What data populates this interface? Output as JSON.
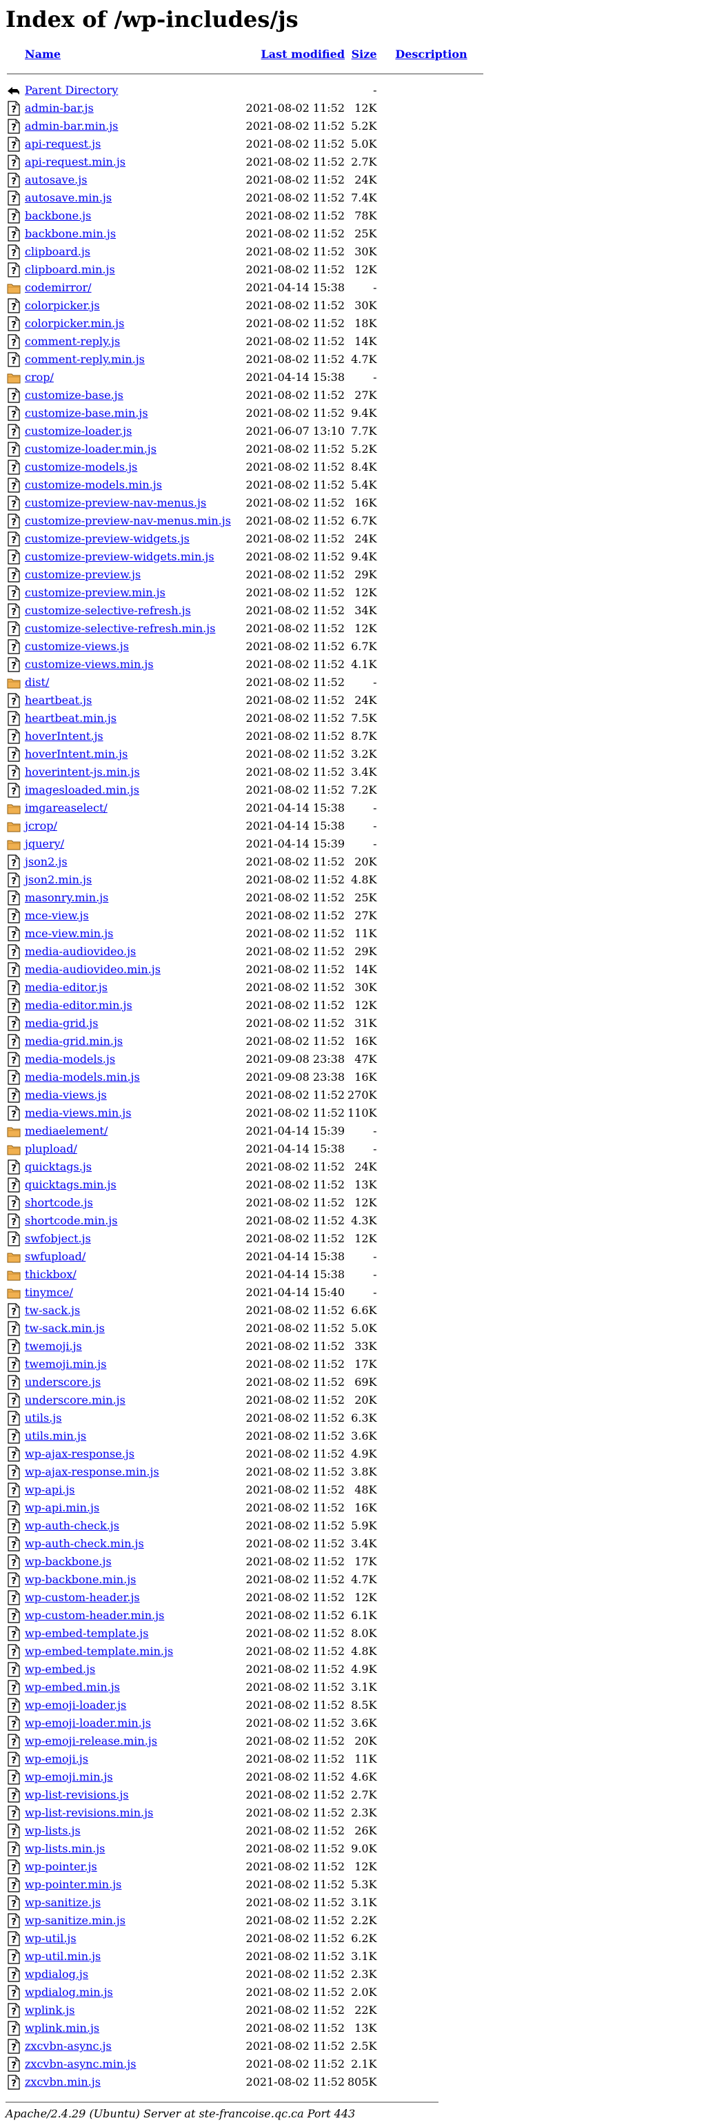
{
  "page": {
    "title": "Index of /wp-includes/js"
  },
  "columns": {
    "name": "Name",
    "last_modified": "Last modified",
    "size": "Size",
    "description": "Description"
  },
  "parent": {
    "name": "Parent Directory",
    "size": "-"
  },
  "entries": [
    {
      "name": "admin-bar.js",
      "modified": "2021-08-02 11:52",
      "size": "12K",
      "type": "file"
    },
    {
      "name": "admin-bar.min.js",
      "modified": "2021-08-02 11:52",
      "size": "5.2K",
      "type": "file"
    },
    {
      "name": "api-request.js",
      "modified": "2021-08-02 11:52",
      "size": "5.0K",
      "type": "file"
    },
    {
      "name": "api-request.min.js",
      "modified": "2021-08-02 11:52",
      "size": "2.7K",
      "type": "file"
    },
    {
      "name": "autosave.js",
      "modified": "2021-08-02 11:52",
      "size": "24K",
      "type": "file"
    },
    {
      "name": "autosave.min.js",
      "modified": "2021-08-02 11:52",
      "size": "7.4K",
      "type": "file"
    },
    {
      "name": "backbone.js",
      "modified": "2021-08-02 11:52",
      "size": "78K",
      "type": "file"
    },
    {
      "name": "backbone.min.js",
      "modified": "2021-08-02 11:52",
      "size": "25K",
      "type": "file"
    },
    {
      "name": "clipboard.js",
      "modified": "2021-08-02 11:52",
      "size": "30K",
      "type": "file"
    },
    {
      "name": "clipboard.min.js",
      "modified": "2021-08-02 11:52",
      "size": "12K",
      "type": "file"
    },
    {
      "name": "codemirror/",
      "modified": "2021-04-14 15:38",
      "size": "-",
      "type": "folder"
    },
    {
      "name": "colorpicker.js",
      "modified": "2021-08-02 11:52",
      "size": "30K",
      "type": "file"
    },
    {
      "name": "colorpicker.min.js",
      "modified": "2021-08-02 11:52",
      "size": "18K",
      "type": "file"
    },
    {
      "name": "comment-reply.js",
      "modified": "2021-08-02 11:52",
      "size": "14K",
      "type": "file"
    },
    {
      "name": "comment-reply.min.js",
      "modified": "2021-08-02 11:52",
      "size": "4.7K",
      "type": "file"
    },
    {
      "name": "crop/",
      "modified": "2021-04-14 15:38",
      "size": "-",
      "type": "folder"
    },
    {
      "name": "customize-base.js",
      "modified": "2021-08-02 11:52",
      "size": "27K",
      "type": "file"
    },
    {
      "name": "customize-base.min.js",
      "modified": "2021-08-02 11:52",
      "size": "9.4K",
      "type": "file"
    },
    {
      "name": "customize-loader.js",
      "modified": "2021-06-07 13:10",
      "size": "7.7K",
      "type": "file"
    },
    {
      "name": "customize-loader.min.js",
      "modified": "2021-08-02 11:52",
      "size": "5.2K",
      "type": "file"
    },
    {
      "name": "customize-models.js",
      "modified": "2021-08-02 11:52",
      "size": "8.4K",
      "type": "file"
    },
    {
      "name": "customize-models.min.js",
      "modified": "2021-08-02 11:52",
      "size": "5.4K",
      "type": "file"
    },
    {
      "name": "customize-preview-nav-menus.js",
      "modified": "2021-08-02 11:52",
      "size": "16K",
      "type": "file"
    },
    {
      "name": "customize-preview-nav-menus.min.js",
      "modified": "2021-08-02 11:52",
      "size": "6.7K",
      "type": "file"
    },
    {
      "name": "customize-preview-widgets.js",
      "modified": "2021-08-02 11:52",
      "size": "24K",
      "type": "file"
    },
    {
      "name": "customize-preview-widgets.min.js",
      "modified": "2021-08-02 11:52",
      "size": "9.4K",
      "type": "file"
    },
    {
      "name": "customize-preview.js",
      "modified": "2021-08-02 11:52",
      "size": "29K",
      "type": "file"
    },
    {
      "name": "customize-preview.min.js",
      "modified": "2021-08-02 11:52",
      "size": "12K",
      "type": "file"
    },
    {
      "name": "customize-selective-refresh.js",
      "modified": "2021-08-02 11:52",
      "size": "34K",
      "type": "file"
    },
    {
      "name": "customize-selective-refresh.min.js",
      "modified": "2021-08-02 11:52",
      "size": "12K",
      "type": "file"
    },
    {
      "name": "customize-views.js",
      "modified": "2021-08-02 11:52",
      "size": "6.7K",
      "type": "file"
    },
    {
      "name": "customize-views.min.js",
      "modified": "2021-08-02 11:52",
      "size": "4.1K",
      "type": "file"
    },
    {
      "name": "dist/",
      "modified": "2021-08-02 11:52",
      "size": "-",
      "type": "folder"
    },
    {
      "name": "heartbeat.js",
      "modified": "2021-08-02 11:52",
      "size": "24K",
      "type": "file"
    },
    {
      "name": "heartbeat.min.js",
      "modified": "2021-08-02 11:52",
      "size": "7.5K",
      "type": "file"
    },
    {
      "name": "hoverIntent.js",
      "modified": "2021-08-02 11:52",
      "size": "8.7K",
      "type": "file"
    },
    {
      "name": "hoverIntent.min.js",
      "modified": "2021-08-02 11:52",
      "size": "3.2K",
      "type": "file"
    },
    {
      "name": "hoverintent-js.min.js",
      "modified": "2021-08-02 11:52",
      "size": "3.4K",
      "type": "file"
    },
    {
      "name": "imagesloaded.min.js",
      "modified": "2021-08-02 11:52",
      "size": "7.2K",
      "type": "file"
    },
    {
      "name": "imgareaselect/",
      "modified": "2021-04-14 15:38",
      "size": "-",
      "type": "folder"
    },
    {
      "name": "jcrop/",
      "modified": "2021-04-14 15:38",
      "size": "-",
      "type": "folder"
    },
    {
      "name": "jquery/",
      "modified": "2021-04-14 15:39",
      "size": "-",
      "type": "folder"
    },
    {
      "name": "json2.js",
      "modified": "2021-08-02 11:52",
      "size": "20K",
      "type": "file"
    },
    {
      "name": "json2.min.js",
      "modified": "2021-08-02 11:52",
      "size": "4.8K",
      "type": "file"
    },
    {
      "name": "masonry.min.js",
      "modified": "2021-08-02 11:52",
      "size": "25K",
      "type": "file"
    },
    {
      "name": "mce-view.js",
      "modified": "2021-08-02 11:52",
      "size": "27K",
      "type": "file"
    },
    {
      "name": "mce-view.min.js",
      "modified": "2021-08-02 11:52",
      "size": "11K",
      "type": "file"
    },
    {
      "name": "media-audiovideo.js",
      "modified": "2021-08-02 11:52",
      "size": "29K",
      "type": "file"
    },
    {
      "name": "media-audiovideo.min.js",
      "modified": "2021-08-02 11:52",
      "size": "14K",
      "type": "file"
    },
    {
      "name": "media-editor.js",
      "modified": "2021-08-02 11:52",
      "size": "30K",
      "type": "file"
    },
    {
      "name": "media-editor.min.js",
      "modified": "2021-08-02 11:52",
      "size": "12K",
      "type": "file"
    },
    {
      "name": "media-grid.js",
      "modified": "2021-08-02 11:52",
      "size": "31K",
      "type": "file"
    },
    {
      "name": "media-grid.min.js",
      "modified": "2021-08-02 11:52",
      "size": "16K",
      "type": "file"
    },
    {
      "name": "media-models.js",
      "modified": "2021-09-08 23:38",
      "size": "47K",
      "type": "file"
    },
    {
      "name": "media-models.min.js",
      "modified": "2021-09-08 23:38",
      "size": "16K",
      "type": "file"
    },
    {
      "name": "media-views.js",
      "modified": "2021-08-02 11:52",
      "size": "270K",
      "type": "file"
    },
    {
      "name": "media-views.min.js",
      "modified": "2021-08-02 11:52",
      "size": "110K",
      "type": "file"
    },
    {
      "name": "mediaelement/",
      "modified": "2021-04-14 15:39",
      "size": "-",
      "type": "folder"
    },
    {
      "name": "plupload/",
      "modified": "2021-04-14 15:38",
      "size": "-",
      "type": "folder"
    },
    {
      "name": "quicktags.js",
      "modified": "2021-08-02 11:52",
      "size": "24K",
      "type": "file"
    },
    {
      "name": "quicktags.min.js",
      "modified": "2021-08-02 11:52",
      "size": "13K",
      "type": "file"
    },
    {
      "name": "shortcode.js",
      "modified": "2021-08-02 11:52",
      "size": "12K",
      "type": "file"
    },
    {
      "name": "shortcode.min.js",
      "modified": "2021-08-02 11:52",
      "size": "4.3K",
      "type": "file"
    },
    {
      "name": "swfobject.js",
      "modified": "2021-08-02 11:52",
      "size": "12K",
      "type": "file"
    },
    {
      "name": "swfupload/",
      "modified": "2021-04-14 15:38",
      "size": "-",
      "type": "folder"
    },
    {
      "name": "thickbox/",
      "modified": "2021-04-14 15:38",
      "size": "-",
      "type": "folder"
    },
    {
      "name": "tinymce/",
      "modified": "2021-04-14 15:40",
      "size": "-",
      "type": "folder"
    },
    {
      "name": "tw-sack.js",
      "modified": "2021-08-02 11:52",
      "size": "6.6K",
      "type": "file"
    },
    {
      "name": "tw-sack.min.js",
      "modified": "2021-08-02 11:52",
      "size": "5.0K",
      "type": "file"
    },
    {
      "name": "twemoji.js",
      "modified": "2021-08-02 11:52",
      "size": "33K",
      "type": "file"
    },
    {
      "name": "twemoji.min.js",
      "modified": "2021-08-02 11:52",
      "size": "17K",
      "type": "file"
    },
    {
      "name": "underscore.js",
      "modified": "2021-08-02 11:52",
      "size": "69K",
      "type": "file"
    },
    {
      "name": "underscore.min.js",
      "modified": "2021-08-02 11:52",
      "size": "20K",
      "type": "file"
    },
    {
      "name": "utils.js",
      "modified": "2021-08-02 11:52",
      "size": "6.3K",
      "type": "file"
    },
    {
      "name": "utils.min.js",
      "modified": "2021-08-02 11:52",
      "size": "3.6K",
      "type": "file"
    },
    {
      "name": "wp-ajax-response.js",
      "modified": "2021-08-02 11:52",
      "size": "4.9K",
      "type": "file"
    },
    {
      "name": "wp-ajax-response.min.js",
      "modified": "2021-08-02 11:52",
      "size": "3.8K",
      "type": "file"
    },
    {
      "name": "wp-api.js",
      "modified": "2021-08-02 11:52",
      "size": "48K",
      "type": "file"
    },
    {
      "name": "wp-api.min.js",
      "modified": "2021-08-02 11:52",
      "size": "16K",
      "type": "file"
    },
    {
      "name": "wp-auth-check.js",
      "modified": "2021-08-02 11:52",
      "size": "5.9K",
      "type": "file"
    },
    {
      "name": "wp-auth-check.min.js",
      "modified": "2021-08-02 11:52",
      "size": "3.4K",
      "type": "file"
    },
    {
      "name": "wp-backbone.js",
      "modified": "2021-08-02 11:52",
      "size": "17K",
      "type": "file"
    },
    {
      "name": "wp-backbone.min.js",
      "modified": "2021-08-02 11:52",
      "size": "4.7K",
      "type": "file"
    },
    {
      "name": "wp-custom-header.js",
      "modified": "2021-08-02 11:52",
      "size": "12K",
      "type": "file"
    },
    {
      "name": "wp-custom-header.min.js",
      "modified": "2021-08-02 11:52",
      "size": "6.1K",
      "type": "file"
    },
    {
      "name": "wp-embed-template.js",
      "modified": "2021-08-02 11:52",
      "size": "8.0K",
      "type": "file"
    },
    {
      "name": "wp-embed-template.min.js",
      "modified": "2021-08-02 11:52",
      "size": "4.8K",
      "type": "file"
    },
    {
      "name": "wp-embed.js",
      "modified": "2021-08-02 11:52",
      "size": "4.9K",
      "type": "file"
    },
    {
      "name": "wp-embed.min.js",
      "modified": "2021-08-02 11:52",
      "size": "3.1K",
      "type": "file"
    },
    {
      "name": "wp-emoji-loader.js",
      "modified": "2021-08-02 11:52",
      "size": "8.5K",
      "type": "file"
    },
    {
      "name": "wp-emoji-loader.min.js",
      "modified": "2021-08-02 11:52",
      "size": "3.6K",
      "type": "file"
    },
    {
      "name": "wp-emoji-release.min.js",
      "modified": "2021-08-02 11:52",
      "size": "20K",
      "type": "file"
    },
    {
      "name": "wp-emoji.js",
      "modified": "2021-08-02 11:52",
      "size": "11K",
      "type": "file"
    },
    {
      "name": "wp-emoji.min.js",
      "modified": "2021-08-02 11:52",
      "size": "4.6K",
      "type": "file"
    },
    {
      "name": "wp-list-revisions.js",
      "modified": "2021-08-02 11:52",
      "size": "2.7K",
      "type": "file"
    },
    {
      "name": "wp-list-revisions.min.js",
      "modified": "2021-08-02 11:52",
      "size": "2.3K",
      "type": "file"
    },
    {
      "name": "wp-lists.js",
      "modified": "2021-08-02 11:52",
      "size": "26K",
      "type": "file"
    },
    {
      "name": "wp-lists.min.js",
      "modified": "2021-08-02 11:52",
      "size": "9.0K",
      "type": "file"
    },
    {
      "name": "wp-pointer.js",
      "modified": "2021-08-02 11:52",
      "size": "12K",
      "type": "file"
    },
    {
      "name": "wp-pointer.min.js",
      "modified": "2021-08-02 11:52",
      "size": "5.3K",
      "type": "file"
    },
    {
      "name": "wp-sanitize.js",
      "modified": "2021-08-02 11:52",
      "size": "3.1K",
      "type": "file"
    },
    {
      "name": "wp-sanitize.min.js",
      "modified": "2021-08-02 11:52",
      "size": "2.2K",
      "type": "file"
    },
    {
      "name": "wp-util.js",
      "modified": "2021-08-02 11:52",
      "size": "6.2K",
      "type": "file"
    },
    {
      "name": "wp-util.min.js",
      "modified": "2021-08-02 11:52",
      "size": "3.1K",
      "type": "file"
    },
    {
      "name": "wpdialog.js",
      "modified": "2021-08-02 11:52",
      "size": "2.3K",
      "type": "file"
    },
    {
      "name": "wpdialog.min.js",
      "modified": "2021-08-02 11:52",
      "size": "2.0K",
      "type": "file"
    },
    {
      "name": "wplink.js",
      "modified": "2021-08-02 11:52",
      "size": "22K",
      "type": "file"
    },
    {
      "name": "wplink.min.js",
      "modified": "2021-08-02 11:52",
      "size": "13K",
      "type": "file"
    },
    {
      "name": "zxcvbn-async.js",
      "modified": "2021-08-02 11:52",
      "size": "2.5K",
      "type": "file"
    },
    {
      "name": "zxcvbn-async.min.js",
      "modified": "2021-08-02 11:52",
      "size": "2.1K",
      "type": "file"
    },
    {
      "name": "zxcvbn.min.js",
      "modified": "2021-08-02 11:52",
      "size": "805K",
      "type": "file"
    }
  ],
  "footer": {
    "address": "Apache/2.4.29 (Ubuntu) Server at ste-francoise.qc.ca Port 443"
  },
  "icons": {
    "file": "unknown-file-icon",
    "folder": "folder-icon",
    "parent": "back-arrow-icon"
  },
  "colors": {
    "link": "#0000ee",
    "folder": "#f0b050",
    "rule": "#a0a0a0"
  }
}
